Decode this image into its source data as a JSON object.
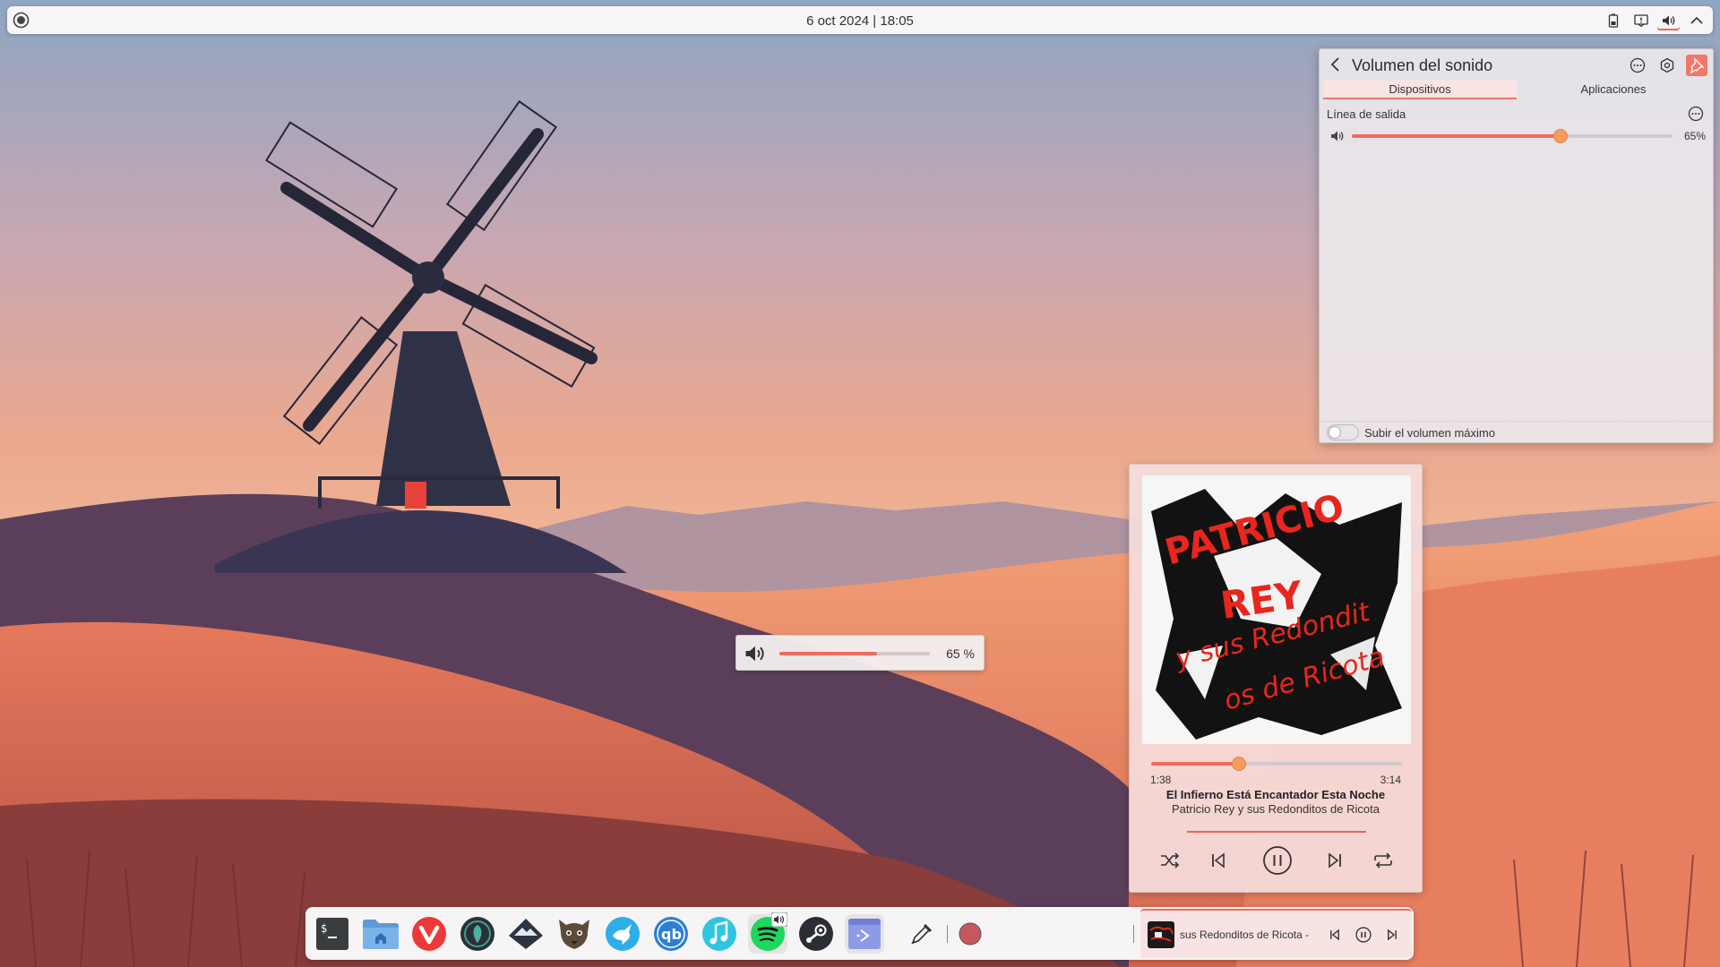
{
  "top_panel": {
    "clock": "6 oct 2024 | 18:05",
    "tray_icons": [
      "battery-icon",
      "notifications-icon",
      "volume-icon",
      "chevron-up-icon"
    ]
  },
  "volume_popup": {
    "title": "Volumen del sonido",
    "tabs": [
      {
        "label": "Dispositivos",
        "active": true
      },
      {
        "label": "Aplicaciones",
        "active": false
      }
    ],
    "device": {
      "label": "Línea de salida",
      "volume": 65,
      "volume_text": "65%"
    },
    "raise_max_label": "Subir el volumen máximo",
    "raise_max_enabled": false
  },
  "osd": {
    "volume": 65,
    "volume_text": "65 %"
  },
  "player": {
    "current_time": "1:38",
    "total_time": "3:14",
    "progress": 0.35,
    "title": "El Infierno Está Encantador Esta Noche",
    "artist": "Patricio Rey y sus Redonditos de Ricota",
    "cover_lines": [
      "PATRICIO",
      "REY",
      "y sus Redondit",
      "os de Ricota"
    ]
  },
  "dock": {
    "apps": [
      {
        "name": "terminal",
        "icon": "terminal-icon"
      },
      {
        "name": "files",
        "icon": "folder-home-icon"
      },
      {
        "name": "vivaldi",
        "icon": "vivaldi-icon"
      },
      {
        "name": "inkscape",
        "icon": "inkscape-icon"
      },
      {
        "name": "krita",
        "icon": "mountain-icon"
      },
      {
        "name": "gimp",
        "icon": "gimp-icon"
      },
      {
        "name": "kdeconnect",
        "icon": "bird-icon"
      },
      {
        "name": "qbittorrent",
        "icon": "qbittorrent-icon"
      },
      {
        "name": "music",
        "icon": "music-note-icon"
      },
      {
        "name": "spotify",
        "icon": "spotify-icon"
      },
      {
        "name": "steam",
        "icon": "steam-icon"
      },
      {
        "name": "kde-plasma",
        "icon": "plasma-icon"
      }
    ],
    "tray": [
      "color-picker-icon",
      "record-icon"
    ],
    "media_title": "sus Redonditos de Ricota -"
  },
  "colors": {
    "accent": "#ef6b5e",
    "knob": "#f69a5e",
    "panel_bg": "#f7f5f5"
  }
}
